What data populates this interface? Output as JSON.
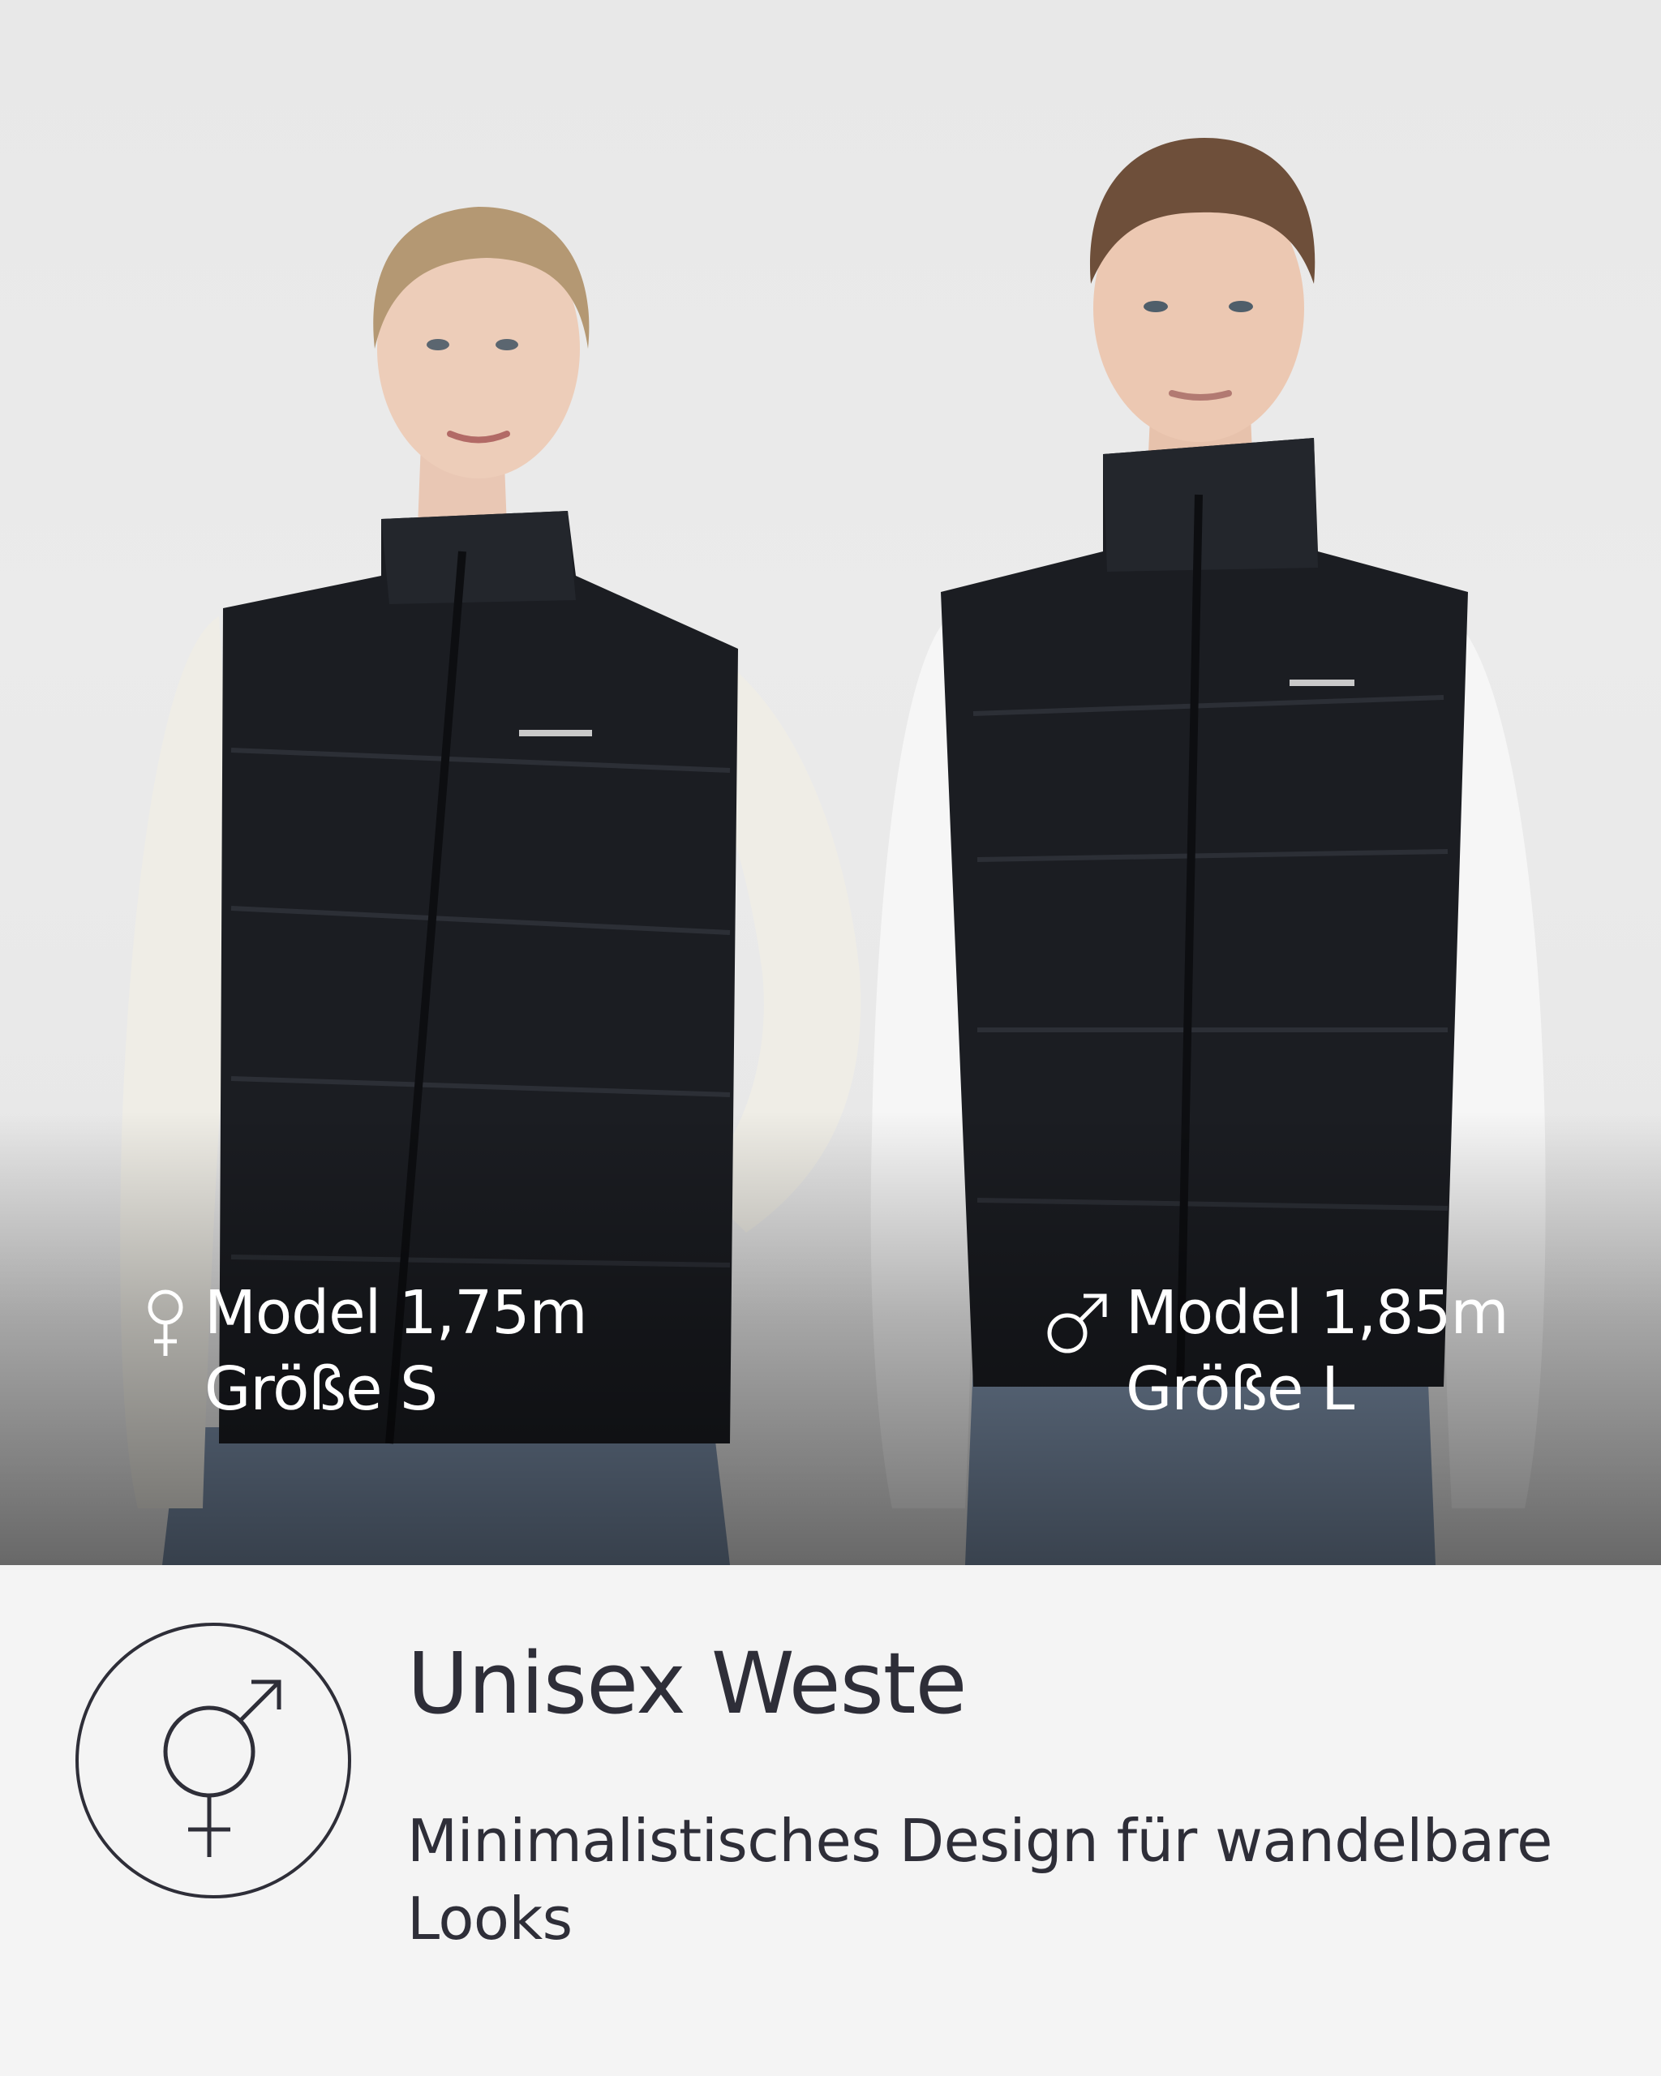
{
  "models": [
    {
      "gender_icon": "female-symbol-icon",
      "height_text": "Model 1,75m",
      "size_text": "Größe S"
    },
    {
      "gender_icon": "male-symbol-icon",
      "height_text": "Model 1,85m",
      "size_text": "Größe L"
    }
  ],
  "product": {
    "badge_icon": "unisex-symbol-icon",
    "title": "Unisex Weste",
    "description": "Minimalistisches Design für wandelbare Looks"
  },
  "colors": {
    "background": "#f4f4f4",
    "text": "#2e2e38",
    "overlay_text": "#ffffff",
    "vest": "#1b1d22"
  }
}
